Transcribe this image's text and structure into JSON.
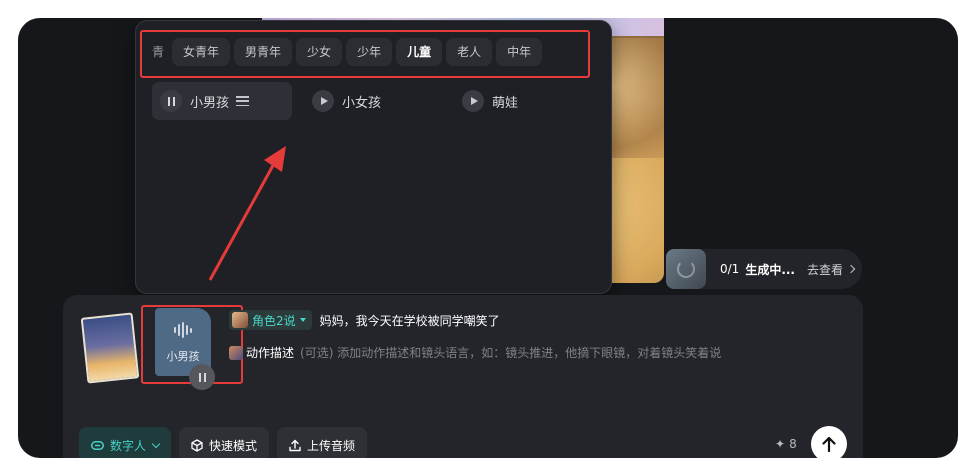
{
  "voice_panel": {
    "categories": [
      {
        "label": "青",
        "partial": true
      },
      {
        "label": "女青年"
      },
      {
        "label": "男青年"
      },
      {
        "label": "少女"
      },
      {
        "label": "少年"
      },
      {
        "label": "儿童",
        "active": true
      },
      {
        "label": "老人"
      },
      {
        "label": "中年"
      }
    ],
    "voices": [
      {
        "label": "小男孩",
        "state": "playing",
        "selected": true
      },
      {
        "label": "小女孩",
        "state": "paused"
      },
      {
        "label": "萌娃",
        "state": "paused"
      }
    ]
  },
  "progress": {
    "count": "0/1",
    "status": "生成中...",
    "link": "去查看"
  },
  "composer": {
    "audio_label": "小男孩",
    "role_label": "角色2说",
    "dialogue": "妈妈，我今天在学校被同学嘲笑了",
    "action_label": "动作描述",
    "action_hint": "(可选) 添加动作描述和镜头语言，如：镜头推进，他摘下眼镜，对着镜头笑着说",
    "buttons": {
      "digital_human": "数字人",
      "fast_mode": "快速模式",
      "upload_audio": "上传音频"
    },
    "credits": "8"
  },
  "colors": {
    "accent": "#45d2c4",
    "highlight_border": "#e53b3b",
    "panel_bg": "#1f2025",
    "app_bg": "#16171a"
  },
  "icons": [
    "pause-icon",
    "play-icon",
    "sliders-icon",
    "spinner-icon",
    "chevron-right-icon",
    "link-icon",
    "cube-icon",
    "upload-icon",
    "sparkle-icon",
    "arrow-up-icon",
    "waveform-icon",
    "chevron-down-icon"
  ]
}
